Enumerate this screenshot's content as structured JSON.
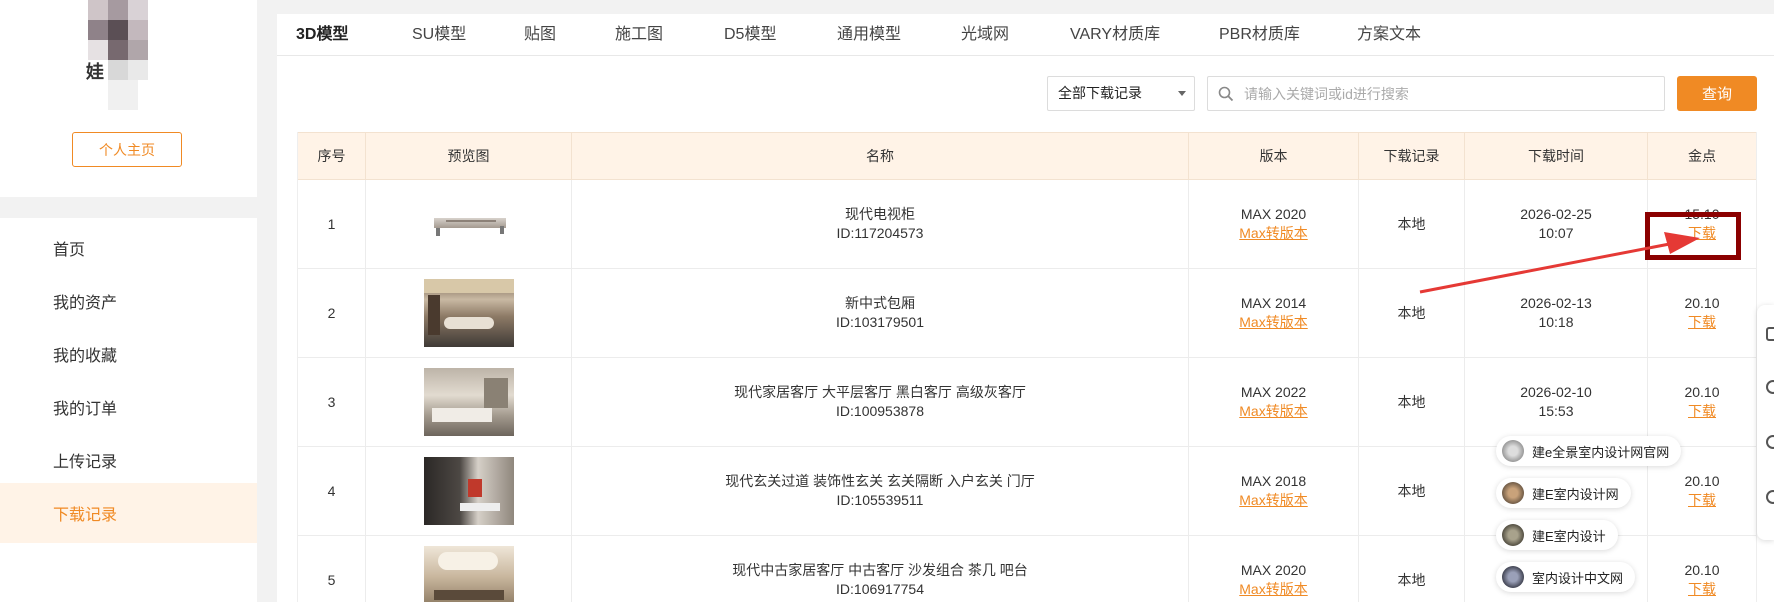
{
  "profile": {
    "name_fragment": "娃",
    "home_button": "个人主页"
  },
  "menu": {
    "items": [
      {
        "label": "首页"
      },
      {
        "label": "我的资产"
      },
      {
        "label": "我的收藏"
      },
      {
        "label": "我的订单"
      },
      {
        "label": "上传记录"
      },
      {
        "label": "下载记录"
      }
    ],
    "active": "下载记录"
  },
  "tabs": [
    {
      "label": "3D模型"
    },
    {
      "label": "SU模型"
    },
    {
      "label": "贴图"
    },
    {
      "label": "施工图"
    },
    {
      "label": "D5模型"
    },
    {
      "label": "通用模型"
    },
    {
      "label": "光域网"
    },
    {
      "label": "VARY材质库"
    },
    {
      "label": "PBR材质库"
    },
    {
      "label": "方案文本"
    }
  ],
  "filter": {
    "selected": "全部下载记录",
    "search_placeholder": "请输入关键词或id进行搜索",
    "search_value": "",
    "query_button": "查询"
  },
  "table": {
    "headers": [
      "序号",
      "预览图",
      "名称",
      "版本",
      "下载记录",
      "下载时间",
      "金点"
    ],
    "rows": [
      {
        "index": "1",
        "name": "现代电视柜",
        "id": "ID:117204573",
        "version": "MAX 2020",
        "convert": "Max转版本",
        "record": "本地",
        "date": "2026-02-25",
        "time": "10:07",
        "points": "15.10",
        "download": "下载"
      },
      {
        "index": "2",
        "name": "新中式包厢",
        "id": "ID:103179501",
        "version": "MAX 2014",
        "convert": "Max转版本",
        "record": "本地",
        "date": "2026-02-13",
        "time": "10:18",
        "points": "20.10",
        "download": "下载"
      },
      {
        "index": "3",
        "name": "现代家居客厅 大平层客厅 黑白客厅 高级灰客厅",
        "id": "ID:100953878",
        "version": "MAX 2022",
        "convert": "Max转版本",
        "record": "本地",
        "date": "2026-02-10",
        "time": "15:53",
        "points": "20.10",
        "download": "下载"
      },
      {
        "index": "4",
        "name": "现代玄关过道 装饰性玄关 玄关隔断 入户玄关 门厅",
        "id": "ID:105539511",
        "version": "MAX 2018",
        "convert": "Max转版本",
        "record": "本地",
        "date": "",
        "time": "",
        "points": "20.10",
        "download": "下载"
      },
      {
        "index": "5",
        "name": "现代中古家居客厅 中古客厅 沙发组合 茶几 吧台",
        "id": "ID:106917754",
        "version": "MAX 2020",
        "convert": "Max转版本",
        "record": "本地",
        "date": "",
        "time": "",
        "points": "20.10",
        "download": "下载"
      }
    ]
  },
  "popups": [
    {
      "label": "建e全景室内设计网官网"
    },
    {
      "label": "建E室内设计网"
    },
    {
      "label": "建E室内设计"
    },
    {
      "label": "室内设计中文网"
    }
  ],
  "colors": {
    "accent": "#f08a24",
    "header_bg": "#fff3e7",
    "highlight": "#8b0000",
    "arrow": "#e53935"
  }
}
